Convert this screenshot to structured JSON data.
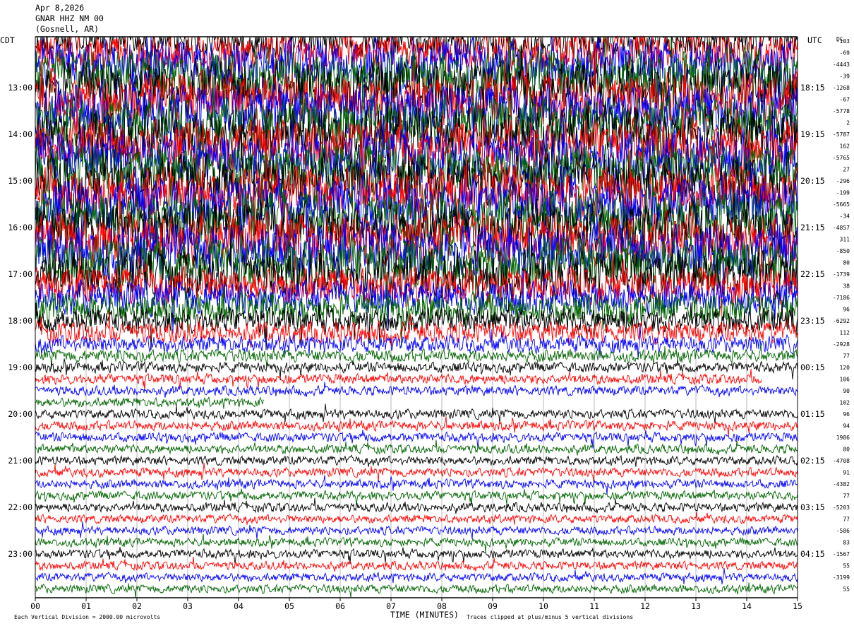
{
  "header": {
    "date": "Apr 8,2026",
    "station": "GNAR HHZ NM 00",
    "location": "(Gosnell, AR)"
  },
  "labels": {
    "left_timezone": "CDT",
    "right_timezone": "UTC",
    "dc_header": "DC",
    "xlabel": "TIME (MINUTES)",
    "footer_left": "Each Vertical Division = 2000.00 microvolts",
    "footer_right": "Traces clipped at plus/minus 5 vertical divisions"
  },
  "chart_data": {
    "type": "line",
    "x_ticks": [
      "00",
      "01",
      "02",
      "03",
      "04",
      "05",
      "06",
      "07",
      "08",
      "09",
      "10",
      "11",
      "12",
      "13",
      "14",
      "15"
    ],
    "xlim": [
      0,
      15
    ],
    "trace_colors": [
      "#000000",
      "#ff0000",
      "#0000ff",
      "#006400"
    ],
    "left_time_labels": [
      "13:00",
      "14:00",
      "15:00",
      "16:00",
      "17:00",
      "18:00",
      "19:00",
      "20:00",
      "21:00",
      "22:00",
      "23:00"
    ],
    "right_time_labels": [
      "18:15",
      "19:15",
      "20:15",
      "21:15",
      "22:15",
      "23:15",
      "00:15",
      "01:15",
      "02:15",
      "03:15",
      "04:15"
    ],
    "dc_offsets": [
      "-103",
      "-69",
      "-4443",
      "-39",
      "-1268",
      "-67",
      "-5778",
      "2",
      "-5787",
      "162",
      "-5765",
      "27",
      "-296",
      "-199",
      "-5665",
      "-34",
      "-4857",
      "311",
      "-850",
      "80",
      "-1739",
      "38",
      "-7186",
      "96",
      "-6292",
      "112",
      "-2928",
      "77",
      "120",
      "106",
      "90",
      "102",
      "96",
      "94",
      "1986",
      "80",
      "-4708",
      "91",
      "-4382",
      "77",
      "-5203",
      "77",
      "-586",
      "83",
      "-1567",
      "55",
      "-3199",
      "55"
    ],
    "amplitude": [
      3.5,
      3.7,
      4.5,
      5.0,
      5.0,
      5.0,
      5.0,
      5.0,
      5.0,
      5.0,
      5.0,
      5.0,
      5.0,
      5.0,
      5.0,
      5.0,
      5.0,
      5.0,
      5.0,
      5.0,
      4.5,
      3.5,
      3.2,
      3.0,
      2.4,
      2.0,
      1.6,
      1.2,
      1.0,
      0.95,
      0.9,
      0.9,
      0.9,
      0.9,
      0.9,
      0.85,
      0.85,
      0.85,
      0.85,
      0.85,
      0.85,
      0.8,
      0.8,
      0.8,
      0.85,
      0.8,
      0.8,
      0.8
    ],
    "trace_end_minutes": {
      "29": 14.3,
      "31": 4.5
    }
  }
}
